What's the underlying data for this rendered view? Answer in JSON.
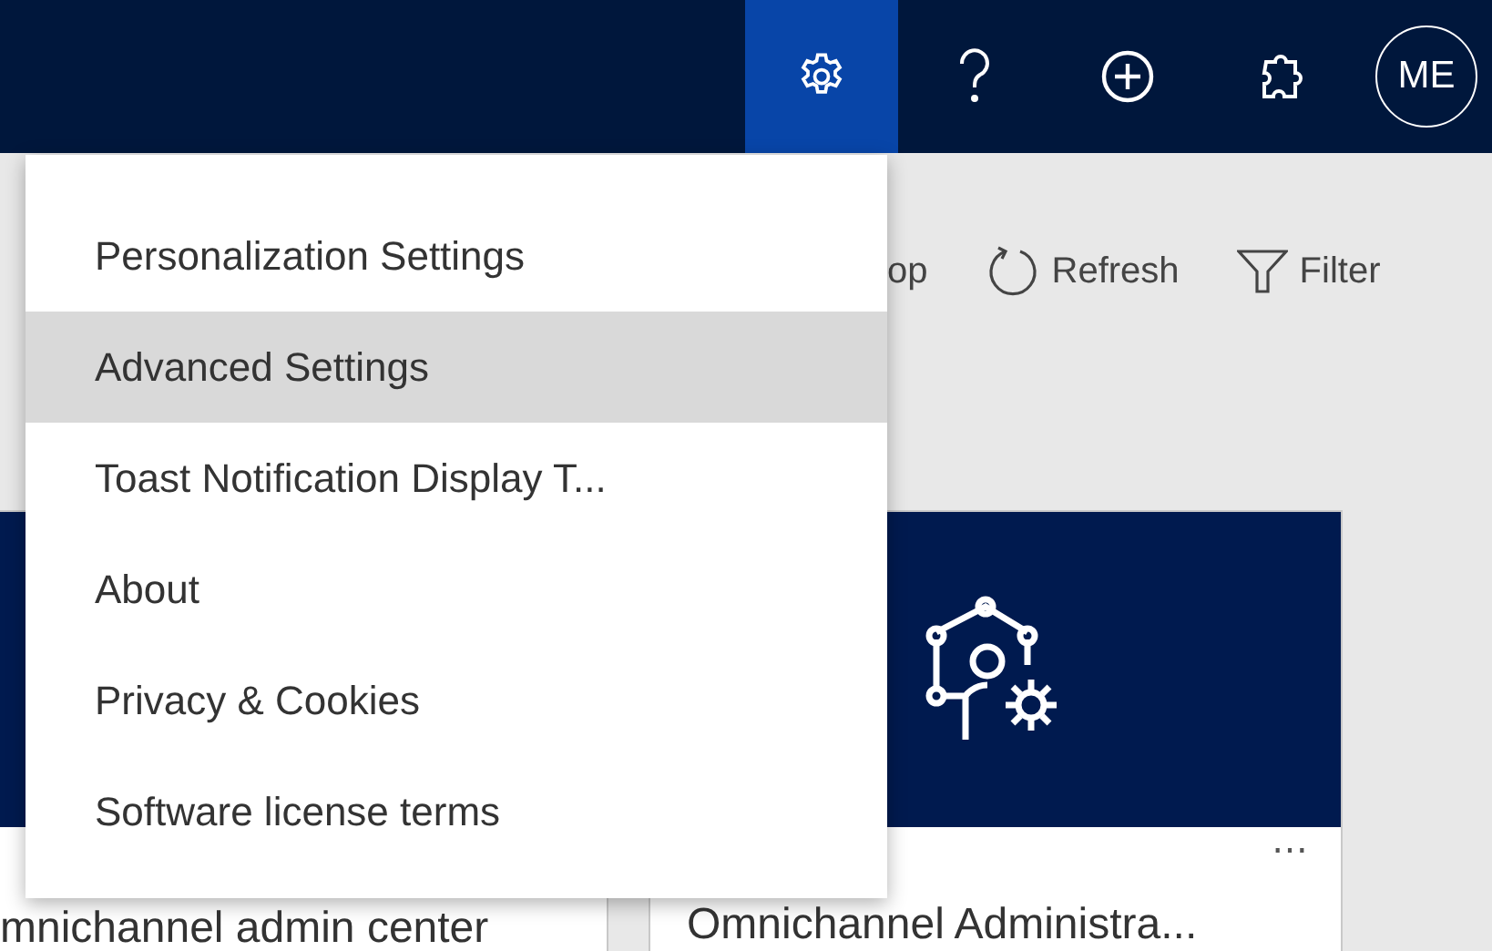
{
  "header": {
    "buttons": [
      {
        "kind": "settings",
        "selected": true
      },
      {
        "kind": "help",
        "selected": false
      },
      {
        "kind": "add",
        "selected": false
      },
      {
        "kind": "puzzle",
        "selected": false
      },
      {
        "kind": "avatar",
        "label": "ME"
      }
    ]
  },
  "toolbar": {
    "items": [
      {
        "kind": "partial",
        "label": "op"
      },
      {
        "kind": "refresh",
        "label": "Refresh"
      },
      {
        "kind": "filter",
        "label": "Filter"
      }
    ]
  },
  "cards": [
    {
      "kind": "plain",
      "title": "mnichannel admin center"
    },
    {
      "kind": "admin",
      "title": "Omnichannel Administra...",
      "more": "⋯"
    }
  ],
  "settings_menu": {
    "items": [
      {
        "label": "Personalization Settings",
        "highlighted": false
      },
      {
        "label": "Advanced Settings",
        "highlighted": true
      },
      {
        "label": "Toast Notification Display T...",
        "highlighted": false
      },
      {
        "label": "About",
        "highlighted": false
      },
      {
        "label": "Privacy & Cookies",
        "highlighted": false
      },
      {
        "label": "Software license terms",
        "highlighted": false
      }
    ]
  }
}
